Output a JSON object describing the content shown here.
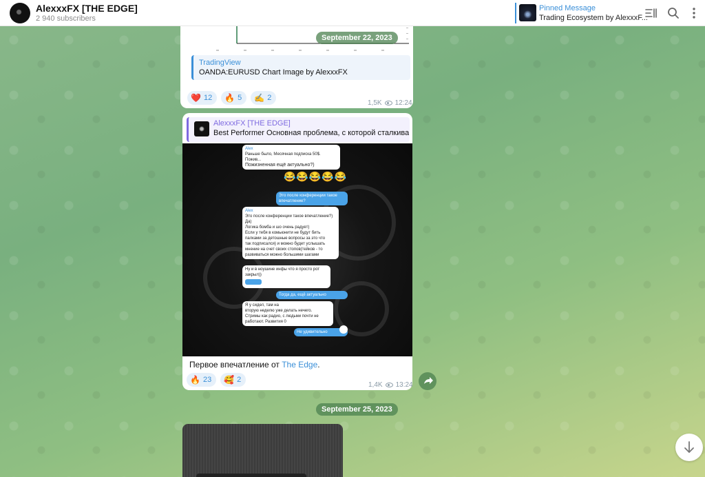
{
  "header": {
    "channel_name": "AlexxxFX [THE EDGE]",
    "subscribers": "2 940 subscribers",
    "pinned_title": "Pinned Message",
    "pinned_text": "Trading Ecosystem by AlexxxF..."
  },
  "dates": [
    "September 22, 2023",
    "September 25, 2023"
  ],
  "post1": {
    "link_site": "TradingView",
    "link_title": "OANDA:EURUSD Chart Image by AlexxxFX",
    "reactions": [
      {
        "emoji": "❤️",
        "count": "12"
      },
      {
        "emoji": "🔥",
        "count": "5"
      },
      {
        "emoji": "✍️",
        "count": "2"
      }
    ],
    "views": "1,5K",
    "time": "12:24"
  },
  "post2": {
    "forward_from": "AlexxxFX [THE EDGE]",
    "forward_text": "Best Performer Основная проблема, с которой сталкиваютс...",
    "screenshot": {
      "b1_name": "Alex",
      "b1_quote": "Раньше было, Месячная подписка 50$. Пожив...",
      "b1_text": "Пожизненная ещё актуально?)",
      "emojis": "😂😂😂😂😂",
      "b2_text": "Это после конференции такое впечатление?",
      "b3_name": "Alex",
      "b3_quote": "Это после конференции такое впечатление?)",
      "b3_lines": [
        "Да)",
        "Логика бомба и шо очень радует)",
        "Если у тебя в комьюнити не будут бить",
        "палками за детошные вопросы за это что",
        "так подписался) и можно будет услышать",
        "мнение на счет своих стопов(тейков - то",
        "развиваться можно большими шагами"
      ],
      "b4_lines": [
        "Ну и в ноушине инфы что я просто рот",
        "закрыл))"
      ],
      "b5_text": "Тогда да, ещё актуально",
      "b6_lines": [
        "Я у               сидел, там на",
        "вторую неделю уже делать нечего.",
        "Стримы как радио, с людьми почти не",
        "работают. Развития 0"
      ],
      "b7_text": "Не удивительно"
    },
    "caption_pre": "Первое впечатление от ",
    "caption_link": "The Edge",
    "caption_post": ".",
    "reactions": [
      {
        "emoji": "🔥",
        "count": "23"
      },
      {
        "emoji": "🥰",
        "count": "2"
      }
    ],
    "views": "1,4K",
    "time": "13:24"
  },
  "colors": {
    "accent": "#3a8fd8",
    "forward": "#7e6ae0",
    "date_pill": "#4c8250"
  },
  "icons": [
    "sidebar-toggle-icon",
    "search-icon",
    "more-icon",
    "share-icon",
    "arrow-down-icon"
  ]
}
